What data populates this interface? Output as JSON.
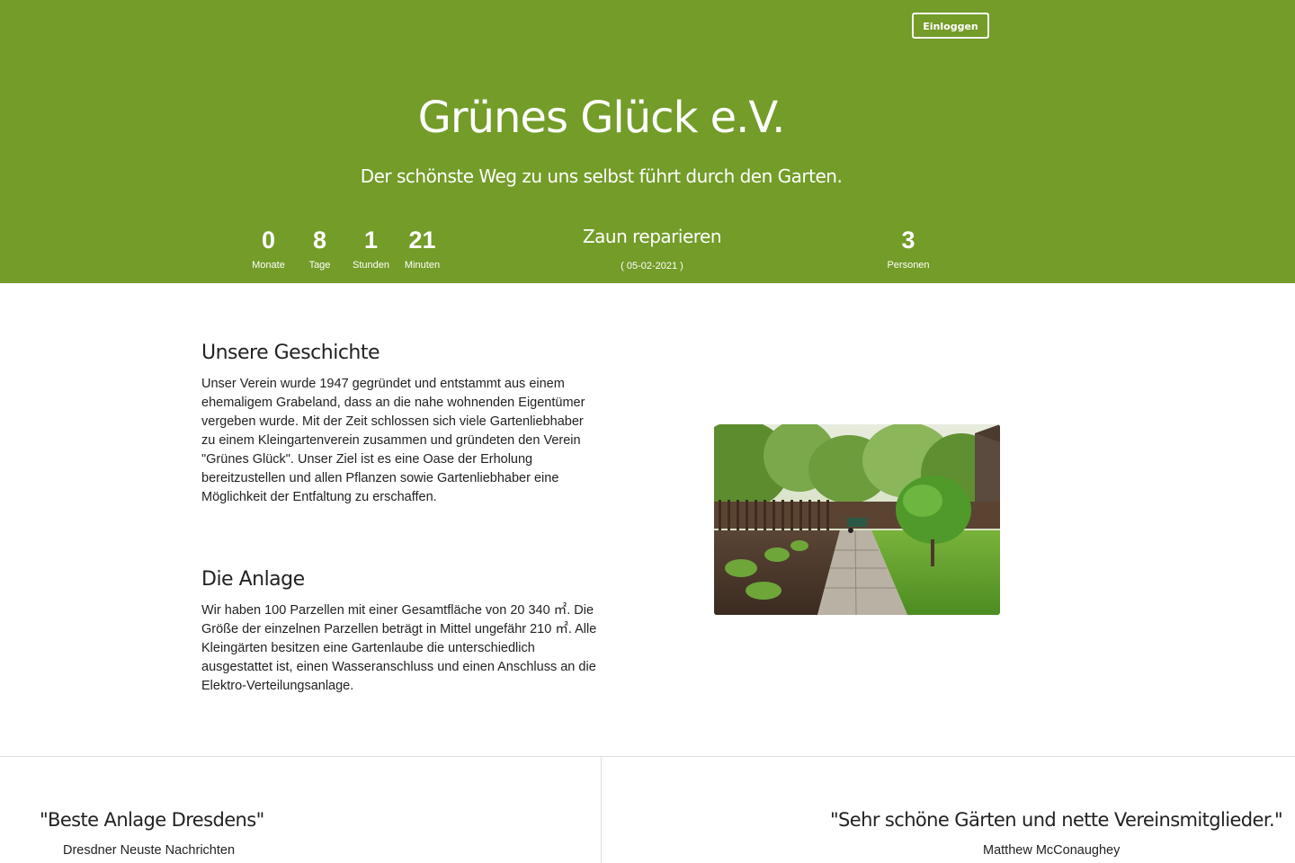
{
  "header": {
    "login_label": "Einloggen",
    "title": "Grünes Glück e.V.",
    "tagline": "Der schönste Weg zu uns selbst führt durch den Garten."
  },
  "countdown": [
    {
      "value": "0",
      "label": "Monate"
    },
    {
      "value": "8",
      "label": "Tage"
    },
    {
      "value": "1",
      "label": "Stunden"
    },
    {
      "value": "21",
      "label": "Minuten"
    }
  ],
  "next_event": {
    "name": "Zaun reparieren",
    "date": "( 05-02-2021 )"
  },
  "participants": {
    "value": "3",
    "label": "Personen"
  },
  "sections": [
    {
      "heading": "Unsere Geschichte",
      "text": "Unser Verein wurde 1947 gegründet und entstammt aus einem ehemaligem Grabeland, dass an die nahe wohnenden Eigentümer vergeben wurde. Mit der Zeit schlossen sich viele Gartenliebhaber zu einem Kleingartenverein zusammen und gründeten den Verein \"Grünes Glück\". Unser Ziel ist es eine Oase der Erholung bereitzustellen und allen Pflanzen sowie Gartenliebhaber eine Möglichkeit der Entfaltung zu erschaffen."
    },
    {
      "heading": "Die Anlage",
      "text": "Wir haben 100 Parzellen mit einer Gesamtfläche von 20 340 ㎡. Die Größe der einzelnen Parzellen beträgt in Mittel ungefähr 210 ㎡. Alle Kleingärten besitzen eine Gartenlaube die unterschiedlich ausgestattet ist, einen Wasseranschluss und einen Anschluss an die Elektro-Verteilungsanlage."
    }
  ],
  "testimonials": [
    {
      "quote": "\"Beste Anlage Dresdens\"",
      "source": "Dresdner Neuste Nachrichten"
    },
    {
      "quote": "\"Sehr schöne Gärten und nette Vereinsmitglieder.\"",
      "source": "Matthew McConaughey"
    }
  ],
  "colors": {
    "brand_green": "#739c28",
    "text": "#222222",
    "divider": "#dddddd"
  }
}
